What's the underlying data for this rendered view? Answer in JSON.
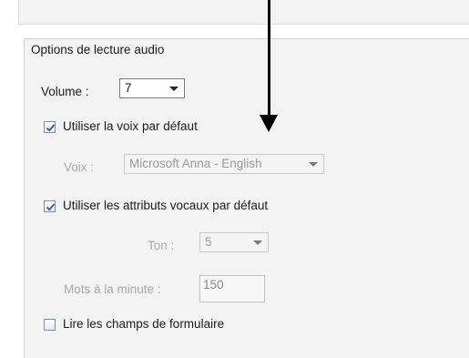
{
  "group": {
    "title": "Options de lecture audio"
  },
  "volume": {
    "label": "Volume :",
    "value": "7"
  },
  "use_default_voice": {
    "label": "Utiliser la voix par défaut",
    "checked": true
  },
  "voice": {
    "label": "Voix :",
    "value": "Microsoft Anna - English",
    "enabled": false
  },
  "use_default_attributes": {
    "label": "Utiliser les attributs vocaux par défaut",
    "checked": true
  },
  "pitch": {
    "label": "Ton :",
    "value": "5",
    "enabled": false
  },
  "words_per_minute": {
    "label": "Mots à la minute :",
    "value": "150",
    "enabled": false
  },
  "read_form_fields": {
    "label": "Lire les champs de formulaire",
    "checked": false
  },
  "annotation": {
    "icon": "down-arrow-icon",
    "color": "#000000"
  }
}
